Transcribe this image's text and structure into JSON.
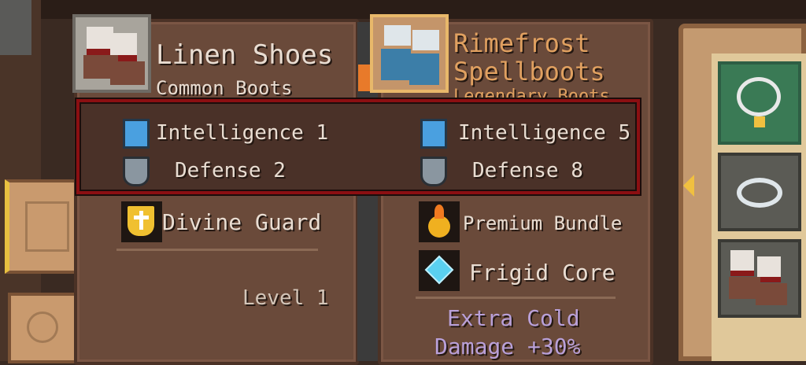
{
  "colors": {
    "panel": "#6a4a3a",
    "panel_dark": "#4b3226",
    "text": "#e9ddd2",
    "legendary": "#e0a060",
    "highlight_box": "#8b0f12",
    "effect_purple": "#b9a0d8"
  },
  "left_item": {
    "name": "Linen Shoes",
    "type": "Common Boots",
    "icon": "linen-boots-icon",
    "stats": [
      {
        "icon": "intelligence-book-icon",
        "label": "Intelligence 1"
      },
      {
        "icon": "defense-shield-icon",
        "label": "Defense 2"
      }
    ],
    "perk": {
      "icon": "divine-guard-icon",
      "label": "Divine Guard"
    },
    "level": "Level 1"
  },
  "right_item": {
    "name_line1": "Rimefrost",
    "name_line2": "Spellboots",
    "type": "Legendary Boots",
    "icon": "rimefrost-boots-icon",
    "stats": [
      {
        "icon": "intelligence-book-icon",
        "label": "Intelligence 5"
      },
      {
        "icon": "defense-shield-icon",
        "label": "Defense 8"
      }
    ],
    "perks": [
      {
        "icon": "flame-orb-icon",
        "label": "Premium Bundle"
      },
      {
        "icon": "ice-crystal-icon",
        "label": "Frigid Core"
      }
    ],
    "effect_line1": "Extra Cold",
    "effect_line2": "Damage +30%"
  },
  "equipment_slots": [
    {
      "icon": "necklace-icon",
      "selected": true
    },
    {
      "icon": "ring-icon",
      "selected": false
    },
    {
      "icon": "boots-icon",
      "selected": false
    }
  ]
}
